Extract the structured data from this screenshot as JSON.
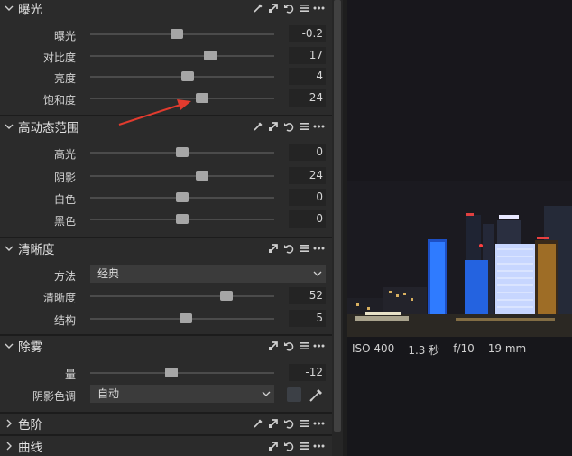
{
  "exposure": {
    "title": "曝光",
    "sliders": [
      {
        "label": "曝光",
        "value": "-0.2",
        "position": 0.47
      },
      {
        "label": "对比度",
        "value": "17",
        "position": 0.65
      },
      {
        "label": "亮度",
        "value": "4",
        "position": 0.53
      },
      {
        "label": "饱和度",
        "value": "24",
        "position": 0.61
      }
    ]
  },
  "hdr": {
    "title": "高动态范围",
    "sliders": [
      {
        "label": "高光",
        "value": "0",
        "position": 0.5
      },
      {
        "label": "阴影",
        "value": "24",
        "position": 0.61
      },
      {
        "label": "白色",
        "value": "0",
        "position": 0.5
      },
      {
        "label": "黑色",
        "value": "0",
        "position": 0.5
      }
    ]
  },
  "clarity": {
    "title": "清晰度",
    "method_label": "方法",
    "method_value": "经典",
    "sliders": [
      {
        "label": "清晰度",
        "value": "52",
        "position": 0.74
      },
      {
        "label": "结构",
        "value": "5",
        "position": 0.52
      }
    ]
  },
  "dehaze": {
    "title": "除雾",
    "sliders": [
      {
        "label": "量",
        "value": "-12",
        "position": 0.44
      }
    ],
    "shadow_tone_label": "阴影色调",
    "shadow_tone_value": "自动"
  },
  "levels": {
    "title": "色阶"
  },
  "curves": {
    "title": "曲线"
  },
  "exif": {
    "iso": "ISO 400",
    "shutter": "1.3 秒",
    "aperture": "f/10",
    "focal": "19 mm"
  },
  "colors": {
    "panel_bg": "#2b2b2b",
    "annotation_arrow": "#e23b2e",
    "neon_blue": "#2f7bff",
    "neon_white": "#d8e4ff"
  },
  "icons": {
    "pipette": "pipette-icon",
    "copy": "copy-adjust-icon",
    "reset": "reset-icon",
    "presets": "presets-icon",
    "more": "more-icon"
  }
}
